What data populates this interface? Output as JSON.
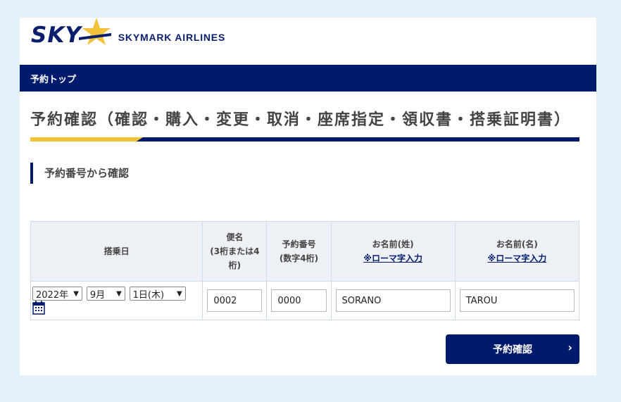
{
  "brand": {
    "logo_text": "SKY",
    "airline_name": "SKYMARK AIRLINES"
  },
  "nav": {
    "label": "予約トップ"
  },
  "page_title": "予約確認（確認・購入・変更・取消・座席指定・領収書・搭乗証明書）",
  "section_title": "予約番号から確認",
  "table": {
    "headers": {
      "boarding_date": "搭乗日",
      "flight_number": "便名",
      "flight_number_note": "(3桁または4桁)",
      "reservation_number": "予約番号",
      "reservation_number_note": "(数字4桁)",
      "last_name": "お名前(姓)",
      "first_name": "お名前(名)",
      "romaji_link": "※ローマ字入力"
    },
    "values": {
      "year": "2022年",
      "month": "9月",
      "day": "1日(木)",
      "flight_number": "0002",
      "reservation_number": "0000",
      "last_name": "SORANO",
      "first_name": "TAROU"
    }
  },
  "submit_button": "予約確認",
  "colors": {
    "navy": "#001a6e",
    "accent_yellow": "#f2c23a",
    "background": "#e3f2f9"
  }
}
